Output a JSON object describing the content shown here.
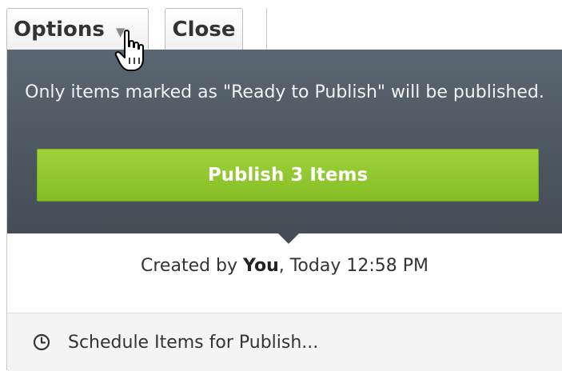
{
  "toolbar": {
    "options_label": "Options",
    "close_label": "Close"
  },
  "publish_panel": {
    "notice_text": "Only items marked as \"Ready to Publish\" will be published.",
    "publish_button_label": "Publish 3 Items",
    "created_prefix": "Created by ",
    "created_by": "You",
    "created_suffix": ", Today 12:58 PM",
    "schedule_label": "Schedule Items for Publish..."
  },
  "icons": {
    "options_dropdown": "chevron-down-icon",
    "schedule": "clock-icon",
    "cursor": "hand-pointer-cursor"
  },
  "colors": {
    "publish_button": "#8cc42b",
    "panel_background": "#4c5660",
    "footer_background": "#f4f4f4"
  }
}
